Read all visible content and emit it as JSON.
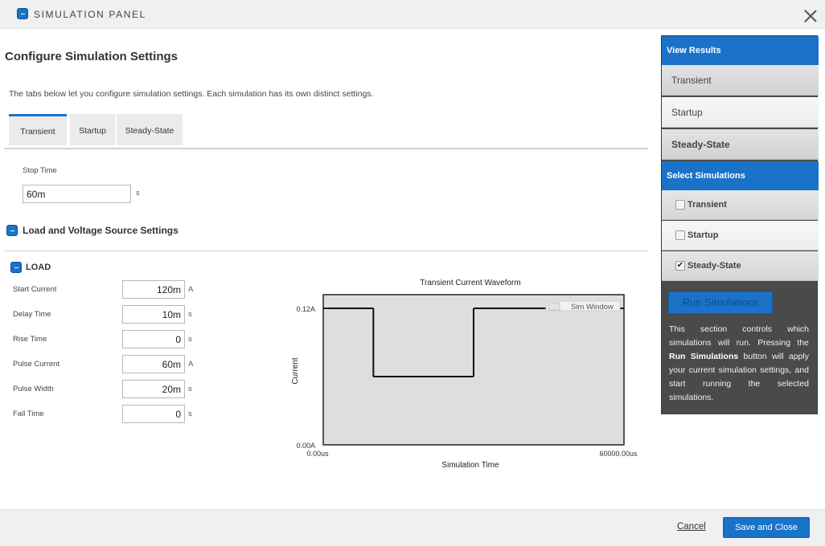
{
  "window": {
    "title": "SIMULATION PANEL",
    "close_icon": "close-icon"
  },
  "main": {
    "heading": "Configure Simulation Settings",
    "intro": "The tabs below let you configure simulation settings. Each simulation has its own distinct settings.",
    "tabs": [
      {
        "label": "Transient",
        "active": true
      },
      {
        "label": "Startup",
        "active": false
      },
      {
        "label": "Steady-State",
        "active": false
      }
    ],
    "stop_time": {
      "label": "Stop Time",
      "value": "60m",
      "unit": "s"
    },
    "source_section_title": "Load and Voltage Source Settings",
    "load": {
      "title": "LOAD",
      "fields": [
        {
          "label": "Start Current",
          "value": "120m",
          "unit": "A"
        },
        {
          "label": "Delay Time",
          "value": "10m",
          "unit": "s"
        },
        {
          "label": "Rise Time",
          "value": "0",
          "unit": "s"
        },
        {
          "label": "Pulse Current",
          "value": "60m",
          "unit": "A"
        },
        {
          "label": "Pulse Width",
          "value": "20m",
          "unit": "s"
        },
        {
          "label": "Fall Time",
          "value": "0",
          "unit": "s"
        }
      ]
    }
  },
  "chart_data": {
    "type": "line",
    "title": "Transient Current Waveform",
    "xlabel": "Simulation Time",
    "ylabel": "Current",
    "x_ticks": [
      "0.00us",
      "60000.00us"
    ],
    "y_ticks": [
      "0.00A",
      "0.12A"
    ],
    "xlim": [
      0,
      60000
    ],
    "ylim": [
      0,
      0.12
    ],
    "legend": {
      "entries": [
        "Sim Window"
      ],
      "placement": "top-right"
    },
    "series": [
      {
        "name": "Sim Window",
        "points": [
          {
            "x": 0,
            "y": 0.12
          },
          {
            "x": 10000,
            "y": 0.12
          },
          {
            "x": 10000,
            "y": 0.06
          },
          {
            "x": 30000,
            "y": 0.06
          },
          {
            "x": 30000,
            "y": 0.12
          },
          {
            "x": 60000,
            "y": 0.12
          }
        ]
      }
    ],
    "colors": {
      "plot_bg": "#dedede",
      "line": "#111111"
    },
    "grid": false
  },
  "right_panel": {
    "view_results_title": "View Results",
    "results": [
      {
        "label": "Transient"
      },
      {
        "label": "Startup"
      },
      {
        "label": "Steady-State"
      }
    ],
    "select_title": "Select Simulations",
    "simulations": [
      {
        "label": "Transient",
        "checked": false
      },
      {
        "label": "Startup",
        "checked": false
      },
      {
        "label": "Steady-State",
        "checked": true
      }
    ],
    "run_button": "Run Simulations",
    "desc_1": "This section controls which simulations will run. Pressing the ",
    "desc_bold": "Run Simulations",
    "desc_2": " button will apply your current simulation settings, and start running the selected simulations."
  },
  "footer": {
    "cancel": "Cancel",
    "save": "Save and Close"
  },
  "colors": {
    "accent": "#1a73c9",
    "panel_dark": "#4a4a4a"
  }
}
